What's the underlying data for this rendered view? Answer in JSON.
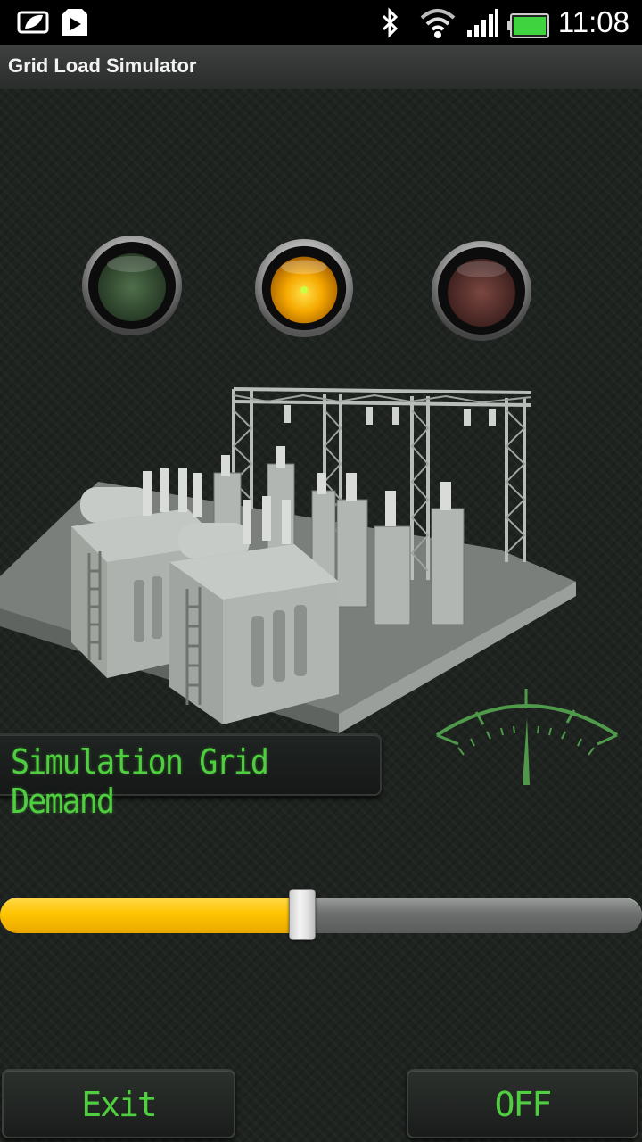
{
  "status_bar": {
    "time": "11:08",
    "icons": [
      "leaf-notification-icon",
      "play-store-icon",
      "bluetooth-icon",
      "wifi-icon",
      "signal-icon",
      "battery-icon"
    ]
  },
  "app": {
    "title": "Grid Load Simulator"
  },
  "lamps": [
    {
      "name": "green",
      "state": "off",
      "color": "#3c5a3c"
    },
    {
      "name": "amber",
      "state": "on",
      "color": "#f5a800"
    },
    {
      "name": "red",
      "state": "off",
      "color": "#5a3030"
    }
  ],
  "panel": {
    "label": "Simulation Grid Demand"
  },
  "slider": {
    "value_fraction": 0.47,
    "fill_color": "#ffc400"
  },
  "buttons": {
    "exit_label": "Exit",
    "toggle_label": "OFF"
  },
  "colors": {
    "accent_text": "#4fcf3f",
    "background": "#1f2320"
  }
}
